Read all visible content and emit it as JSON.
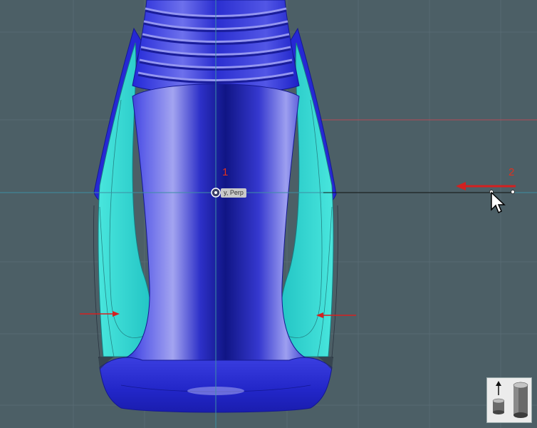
{
  "viewport": {
    "background": "#4c5f66",
    "grid_color": "#566a72",
    "axis_color": "#3d8fa3",
    "body_color": "#2b2fd0",
    "panel_color": "#2fd6cf",
    "arrow_color": "#d42020"
  },
  "annotations": {
    "label_1": "1",
    "label_2": "2",
    "snap_label": "y, Perp"
  },
  "icons": {
    "snap_point": "snap-target-icon",
    "cursor": "arrow-cursor-icon",
    "extrude_widget": "extrude-direction-icon"
  }
}
